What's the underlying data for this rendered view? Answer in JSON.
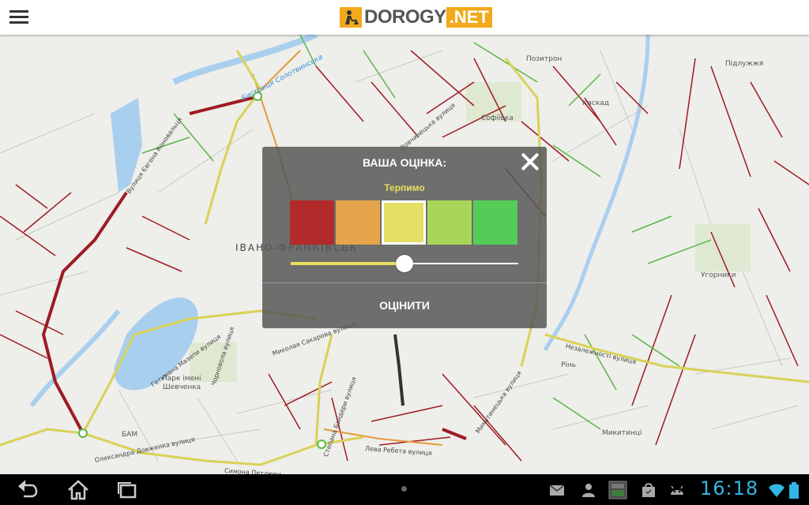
{
  "app": {
    "logo_primary": "DOROGY",
    "logo_secondary": ".NET",
    "brand_color": "#f2a91b"
  },
  "map": {
    "city_label": "ІВАНО-ФРАНКІВСЬК",
    "water_label": "Бистриця Солотвинська",
    "places": [
      {
        "name": "Позитрон"
      },
      {
        "name": "Каскад"
      },
      {
        "name": "Софіївка"
      },
      {
        "name": "Підлужжя"
      },
      {
        "name": "Угорники"
      },
      {
        "name": "Рінь"
      },
      {
        "name": "Микитинці"
      },
      {
        "name": "Парк імені"
      },
      {
        "name": "Шевченка"
      },
      {
        "name": "БАМ"
      }
    ],
    "streets": [
      {
        "name": "Вулиця Євгена Коновальця"
      },
      {
        "name": "Незалежності вулиця"
      },
      {
        "name": "Гетьмана Мазепи вулиця"
      },
      {
        "name": "Чорновола вулиця"
      },
      {
        "name": "Миколая Сакарова вулиця"
      },
      {
        "name": "Степана Бандери вулиця"
      },
      {
        "name": "Олександра Довженка вулиця"
      },
      {
        "name": "Лева Ребета вулиця"
      },
      {
        "name": "Симона Петлюри"
      },
      {
        "name": "Микитинецька вулиця"
      },
      {
        "name": "Вовчинецька вулиця"
      }
    ],
    "traffic_colors": {
      "red": "#9e1b22",
      "orange": "#e59a3c",
      "yellow": "#d8d257",
      "green": "#57b846"
    }
  },
  "dialog": {
    "title": "ВАША ОЦІНКА:",
    "current_rating_label": "Терпимо",
    "rating_options": [
      {
        "color": "#b22a2a"
      },
      {
        "color": "#e4a54a"
      },
      {
        "color": "#e3e064",
        "selected": true
      },
      {
        "color": "#a8d658"
      },
      {
        "color": "#55cc58"
      }
    ],
    "slider_value": 0.5,
    "submit_label": "ОЦІНИТИ",
    "close_icon": "close-icon"
  },
  "system_bar": {
    "clock": "16:18",
    "nav_icons": [
      "back-icon",
      "home-icon",
      "recent-apps-icon"
    ],
    "status_icons": [
      "email-icon",
      "account-icon",
      "app-store-icon",
      "shopping-bag-icon",
      "android-icon",
      "wifi-icon",
      "battery-icon"
    ],
    "clock_color": "#33b5e5"
  }
}
